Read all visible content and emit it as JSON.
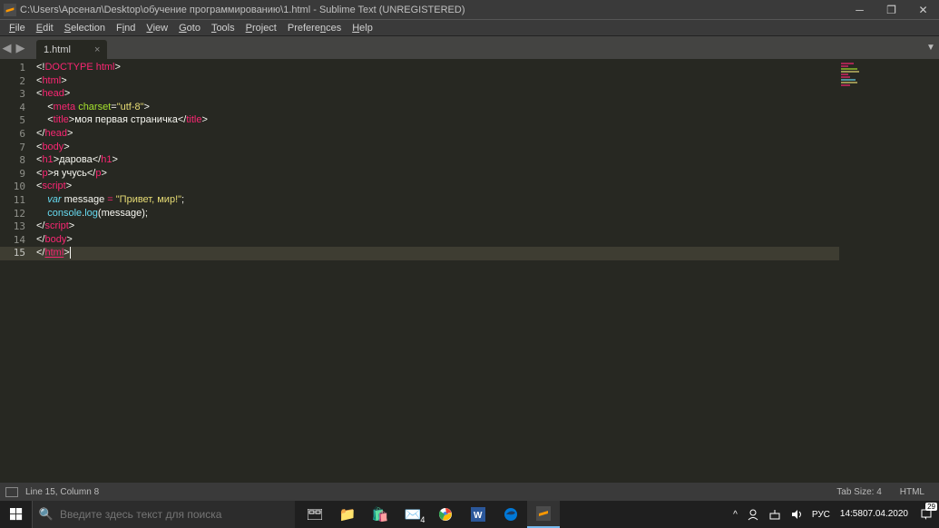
{
  "titlebar": {
    "path": "C:\\Users\\Арсенал\\Desktop\\обучение программированию\\1.html - Sublime Text (UNREGISTERED)"
  },
  "menu": {
    "file": "File",
    "edit": "Edit",
    "selection": "Selection",
    "find": "Find",
    "view": "View",
    "goto": "Goto",
    "tools": "Tools",
    "project": "Project",
    "preferences": "Preferences",
    "help": "Help"
  },
  "tab": {
    "name": "1.html"
  },
  "lines": [
    "1",
    "2",
    "3",
    "4",
    "5",
    "6",
    "7",
    "8",
    "9",
    "10",
    "11",
    "12",
    "13",
    "14",
    "15"
  ],
  "code": {
    "l1_a": "<!",
    "l1_b": "DOCTYPE html",
    "l1_c": ">",
    "l2_a": "<",
    "l2_b": "html",
    "l2_c": ">",
    "l3_a": "<",
    "l3_b": "head",
    "l3_c": ">",
    "l4_a": "    <",
    "l4_b": "meta",
    "l4_c": " ",
    "l4_d": "charset",
    "l4_e": "=",
    "l4_f": "\"utf-8\"",
    "l4_g": ">",
    "l5_a": "    <",
    "l5_b": "title",
    "l5_c": ">",
    "l5_d": "моя первая страничка",
    "l5_e": "</",
    "l5_f": "title",
    "l5_g": ">",
    "l6_a": "</",
    "l6_b": "head",
    "l6_c": ">",
    "l7_a": "<",
    "l7_b": "body",
    "l7_c": ">",
    "l8_a": "<",
    "l8_b": "h1",
    "l8_c": ">",
    "l8_d": "дарова",
    "l8_e": "</",
    "l8_f": "h1",
    "l8_g": ">",
    "l9_a": "<",
    "l9_b": "p",
    "l9_c": ">",
    "l9_d": "я учусь",
    "l9_e": "</",
    "l9_f": "p",
    "l9_g": ">",
    "l10_a": "<",
    "l10_b": "script",
    "l10_c": ">",
    "l11_a": "    ",
    "l11_b": "var",
    "l11_c": " message ",
    "l11_d": "=",
    "l11_e": " ",
    "l11_f": "\"Привет, мир!\"",
    "l11_g": ";",
    "l12_a": "    ",
    "l12_b": "console",
    "l12_c": ".",
    "l12_d": "log",
    "l12_e": "(message);",
    "l13_a": "</",
    "l13_b": "script",
    "l13_c": ">",
    "l14_a": "</",
    "l14_b": "body",
    "l14_c": ">",
    "l15_a": "</",
    "l15_b": "html",
    "l15_c": ">"
  },
  "statusbar": {
    "pos": "Line 15, Column 8",
    "tabsize": "Tab Size: 4",
    "syntax": "HTML"
  },
  "taskbar": {
    "search_placeholder": "Введите здесь текст для поиска"
  },
  "tray": {
    "lang": "РУС",
    "time": "14:58",
    "date": "07.04.2020",
    "notif_count": "29"
  }
}
